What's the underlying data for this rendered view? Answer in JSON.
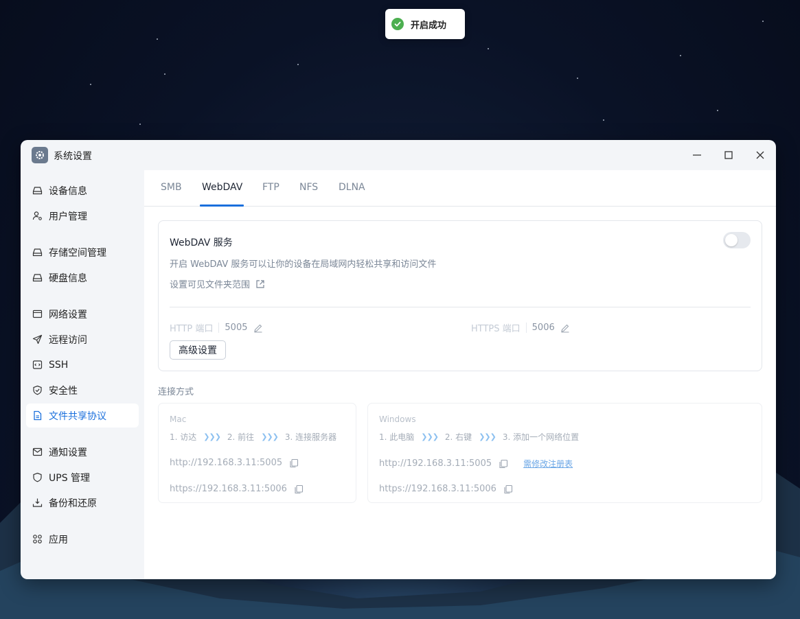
{
  "toast": {
    "text": "开启成功",
    "icon": "check-circle-icon",
    "color": "#4caf50"
  },
  "window": {
    "title": "系统设置",
    "controls": [
      "minimize-icon",
      "maximize-icon",
      "close-icon"
    ]
  },
  "sidebar": {
    "items": [
      {
        "label": "设备信息",
        "icon": "drive-icon"
      },
      {
        "label": "用户管理",
        "icon": "user-icon"
      },
      {
        "label": "存储空间管理",
        "icon": "storage-icon"
      },
      {
        "label": "硬盘信息",
        "icon": "disk-icon"
      },
      {
        "label": "网络设置",
        "icon": "network-icon"
      },
      {
        "label": "远程访问",
        "icon": "send-icon"
      },
      {
        "label": "SSH",
        "icon": "terminal-icon"
      },
      {
        "label": "安全性",
        "icon": "shield-check-icon"
      },
      {
        "label": "文件共享协议",
        "icon": "document-icon",
        "active": true
      },
      {
        "label": "通知设置",
        "icon": "mail-icon"
      },
      {
        "label": "UPS 管理",
        "icon": "ups-shield-icon"
      },
      {
        "label": "备份和还原",
        "icon": "backup-icon"
      },
      {
        "label": "应用",
        "icon": "apps-icon"
      }
    ]
  },
  "tabs": [
    {
      "label": "SMB"
    },
    {
      "label": "WebDAV",
      "active": true
    },
    {
      "label": "FTP"
    },
    {
      "label": "NFS"
    },
    {
      "label": "DLNA"
    }
  ],
  "webdav": {
    "title": "WebDAV 服务",
    "enabled": false,
    "description": "开启 WebDAV 服务可以让你的设备在局域网内轻松共享和访问文件",
    "folder_link": "设置可见文件夹范围",
    "http_label": "HTTP 端口",
    "http_port": "5005",
    "https_label": "HTTPS 端口",
    "https_port": "5006",
    "advanced_button": "高级设置"
  },
  "connection": {
    "title": "连接方式",
    "mac": {
      "os": "Mac",
      "steps": [
        "1. 访达",
        "2. 前往",
        "3. 连接服务器"
      ],
      "http_url": "http://192.168.3.11:5005",
      "https_url": "https://192.168.3.11:5006"
    },
    "windows": {
      "os": "Windows",
      "steps": [
        "1. 此电脑",
        "2. 右键",
        "3. 添加一个网络位置"
      ],
      "http_url": "http://192.168.3.11:5005",
      "https_url": "https://192.168.3.11:5006",
      "registry_link": "需修改注册表"
    }
  },
  "colors": {
    "accent": "#1a6fdc",
    "success": "#4caf50"
  }
}
